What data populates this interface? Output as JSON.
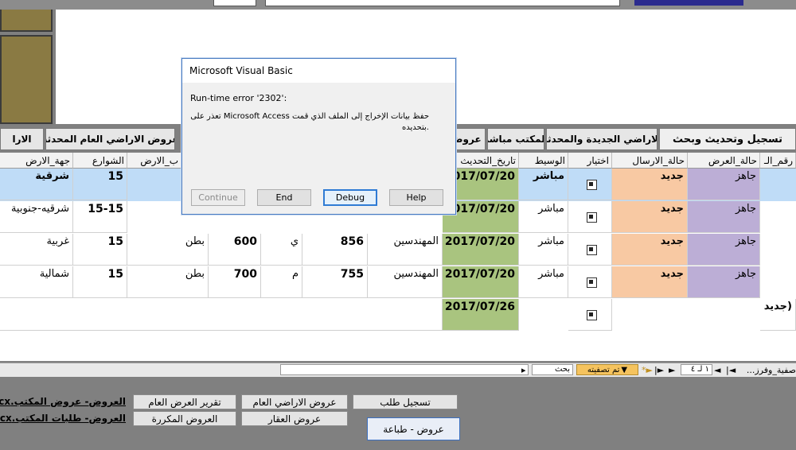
{
  "tabs": {
    "register": "تسجيل وتحديث وبحث",
    "new_updated": "الاراضي الجديدة والمحدثة",
    "direct_office": "المكتب مباشر",
    "offers_cut": "عروض",
    "general_updated": "عروض الاراضي العام المحدثة",
    "left_cut": "الارا"
  },
  "columns": [
    "رقم_الـ",
    "حالة_العرض",
    "حالة_الارسال",
    "اختيار",
    "الوسيط",
    "تاريخ_التحديث",
    "الشوارع",
    "جهة_الارض"
  ],
  "col_extra": "ب_الارض",
  "rows": [
    {
      "status": "جاهز",
      "send": "جديد",
      "broker": "مباشر",
      "date": "2017/07/20",
      "streets": "15",
      "side": "شرقية",
      "area": "",
      "num": "",
      "letter": "",
      "type": "",
      "partial": "",
      "selected": true
    },
    {
      "status": "جاهز",
      "send": "جديد",
      "broker": "مباشر",
      "date": "2017/07/20",
      "streets": "15-15",
      "side": "شرقيه-جنوبية",
      "area": "",
      "num": "",
      "letter": "",
      "type": "",
      "partial": "",
      "selected": false
    },
    {
      "status": "جاهز",
      "send": "جديد",
      "broker": "مباشر",
      "date": "2017/07/20",
      "streets": "15",
      "side": "غربية",
      "area": "المهندسين",
      "num": "856",
      "letter": "ي",
      "type": "بطن",
      "size": "600",
      "selected": false
    },
    {
      "status": "جاهز",
      "send": "جديد",
      "broker": "مباشر",
      "date": "2017/07/20",
      "streets": "15",
      "side": "شمالية",
      "area": "المهندسين",
      "num": "755",
      "letter": "م",
      "type": "بطن",
      "size": "700",
      "selected": false
    }
  ],
  "new_row": {
    "date": "2017/07/26",
    "label": "(جديد"
  },
  "nav": {
    "record": "١ لـ ٤",
    "filtered": "تم تصفيته",
    "search": "بحث",
    "tabname": "صفية_وفرز..."
  },
  "bottom": {
    "register_request": "تسجيل طلب",
    "general_offers": "عروض الاراضي العام",
    "general_report": "تقرير العرض العام",
    "property_offers": "عروض العقار",
    "repeated_offers": "العروض المكررة",
    "print_offers": "عروض - طباعة",
    "link1": "العروض- عروض المكتب.docx",
    "link2": "العروض- طلبات المكتب.docx"
  },
  "dialog": {
    "title": "Microsoft Visual Basic",
    "error": "Run-time error '2302':",
    "message_line1": "حفظ بيانات الإخراج إلى الملف الذي قمت Microsoft Access تعذر على",
    "message_line2": ".بتحديده",
    "continue": "Continue",
    "end": "End",
    "debug": "Debug",
    "help": "Help"
  },
  "colors": {
    "status_purple": "#bcaed6",
    "send_peach": "#f8c9a3",
    "date_green": "#a9c47f",
    "row_highlight": "#bfdcf7",
    "dialog_border": "#4a7cc2"
  }
}
